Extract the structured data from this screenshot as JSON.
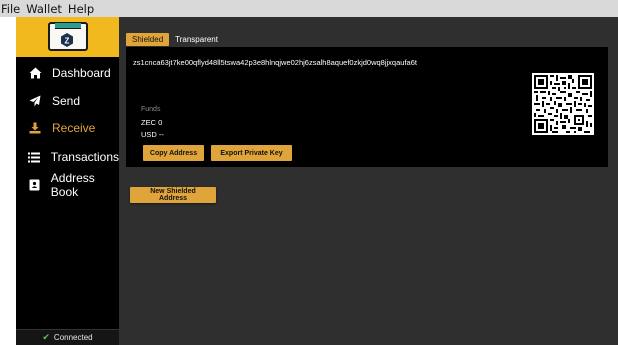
{
  "menu": {
    "items": [
      "File",
      "Wallet",
      "Help"
    ]
  },
  "sidebar": {
    "items": [
      {
        "label": "Dashboard",
        "icon": "home-icon"
      },
      {
        "label": "Send",
        "icon": "send-icon"
      },
      {
        "label": "Receive",
        "icon": "download-icon",
        "active": true
      },
      {
        "label": "Transactions",
        "icon": "list-icon"
      },
      {
        "label": "Address Book",
        "icon": "address-book-icon"
      }
    ],
    "status": "Connected"
  },
  "tabs": [
    {
      "label": "Shielded",
      "active": true
    },
    {
      "label": "Transparent",
      "active": false
    }
  ],
  "address": {
    "value": "zs1cnca63jt7ke00qflyd48ll5tswa42p3e8hlnqjwe02hj6zsalh8aquef0zkjd0wq8jjxqaufa6t",
    "funds_label": "Funds",
    "zec": "ZEC 0",
    "usd": "USD --",
    "copy_label": "Copy Address",
    "export_label": "Export Private Key"
  },
  "new_address_button": "New Shielded Address",
  "colors": {
    "accent": "#e0a53a",
    "logo_bg": "#f2b91e",
    "sidebar_bg": "#000000",
    "main_bg": "#2f2f2f",
    "connected": "#55c94a"
  }
}
